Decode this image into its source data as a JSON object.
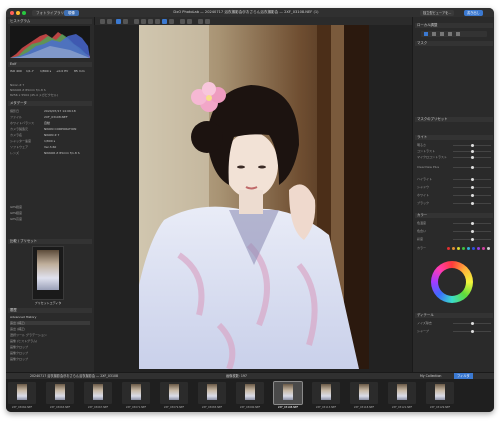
{
  "window": {
    "title": "DxO PhotoLab — 20240717 浴衣撮影会＠おさらん浴衣撮影会 — 2XF_03108.NEF (1)",
    "tabs": [
      {
        "label": "フォトライブラリー"
      },
      {
        "label": "現像"
      }
    ],
    "right_buttons": [
      {
        "label": "独立型ビューアを..."
      },
      {
        "label": "書き出し"
      }
    ]
  },
  "left_panel": {
    "histogram_title": "ヒストグラム",
    "info_title": "Exif",
    "exif_row": [
      "ISO 400",
      "1/1.7",
      "1/800 s",
      "+0.0 EV",
      "85 mm"
    ],
    "camera_line": "Nikon Z 7",
    "lens_line": "NIKKOR Z 85mm f/1.8 S",
    "size_line": "8256 x 5504 (45.4 メガピクセル)",
    "metadata_title": "メタデータ",
    "metadata_rows": [
      {
        "k": "撮影日",
        "v": "2024/07/17 14:06:18"
      },
      {
        "k": "ファイル",
        "v": "2XF_03108.NEF"
      },
      {
        "k": "ホワイトバランス",
        "v": "自動"
      },
      {
        "k": "カメラ製造元",
        "v": "NIKON CORPORATION"
      },
      {
        "k": "カメラ名",
        "v": "NIKON Z 7"
      },
      {
        "k": "シャッター速度",
        "v": "1/800 s"
      },
      {
        "k": "ソフトウェア",
        "v": "Ver.3.60"
      },
      {
        "k": "レンズ",
        "v": "NIKKOR Z 85mm f/1.8 S"
      },
      {
        "k": "GPS緯度",
        "v": ""
      },
      {
        "k": "GPS経度",
        "v": ""
      },
      {
        "k": "GPS高度",
        "v": ""
      }
    ],
    "preset_title": "比較 / プリセット",
    "preset_label": "プリセットエディタ",
    "history_title": "履歴",
    "history_label": "Advanced History",
    "history_items": [
      "露出 (補正)",
      "露出 (補正)",
      "選択ツール グラデーション",
      "画像 (ヒストグラム)",
      "画像クロップ",
      "画像クロップ",
      "画像クロップ"
    ]
  },
  "right_panel": {
    "header": "ローカル調整",
    "sections": [
      {
        "title": "マスク"
      },
      {
        "title": "マスクのプリセット"
      },
      {
        "title": "ライト"
      },
      {
        "title": "カラー"
      },
      {
        "title": "ディテール"
      }
    ],
    "slider_labels": [
      "明るさ",
      "コントラスト",
      "マイクロコントラスト",
      "ClearView Plus",
      "ハイライト",
      "シャドウ",
      "ホワイト",
      "ブラック",
      "色温度",
      "色合い",
      "彩度",
      "ノイズ除去",
      "シャープ"
    ],
    "color_dots_label": "カラー",
    "color_dots": [
      "#e03030",
      "#e09030",
      "#d8d830",
      "#40c040",
      "#30b0d8",
      "#3050e0",
      "#9040e0",
      "#d040a0",
      "#d0d0d0"
    ]
  },
  "status": {
    "left": "20240717 浴衣撮影会＠おさらん浴衣撮影会 — 2XF_03108",
    "center": "画像枚数: 197",
    "right_1": "My Collection",
    "right_2": "フィルタ"
  },
  "filmstrip": [
    {
      "label": "2XF_03060.NEF"
    },
    {
      "label": "2XF_03063.NEF"
    },
    {
      "label": "2XF_03067.NEF"
    },
    {
      "label": "2XF_03071.NEF"
    },
    {
      "label": "2XF_03079.NEF"
    },
    {
      "label": "2XF_03083.NEF"
    },
    {
      "label": "2XF_03090.NEF"
    },
    {
      "label": "2XF_03108.NEF"
    },
    {
      "label": "2XF_03113.NEF"
    },
    {
      "label": "2XF_03118.NEF"
    },
    {
      "label": "2XF_03121.NEF"
    },
    {
      "label": "2XF_03129.NEF"
    }
  ]
}
